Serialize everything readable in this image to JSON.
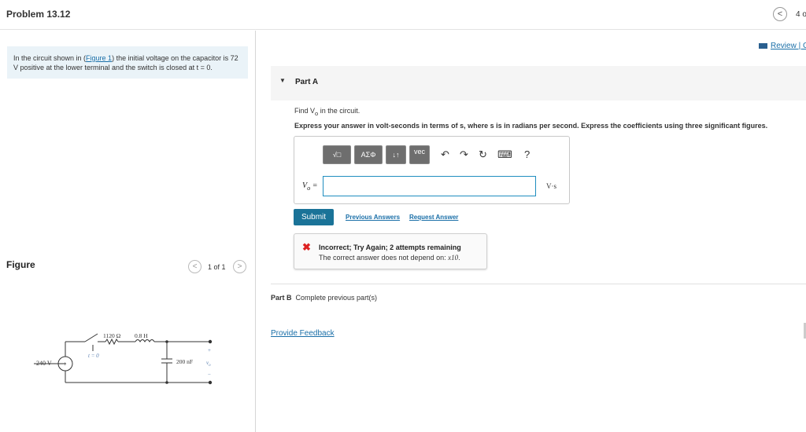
{
  "header": {
    "title": "Problem 13.12",
    "nav_prev_icon": "chevron-left-icon",
    "nav_prev_glyph": "<",
    "count": "4 o"
  },
  "left": {
    "intro_prefix": "In the circuit shown in (",
    "intro_link": "Figure 1",
    "intro_suffix": ") the initial voltage on the capacitor is 72 V positive at the lower terminal and the switch is closed at t = 0.",
    "figure_label": "Figure",
    "figure_prev_glyph": "<",
    "figure_next_glyph": ">",
    "figure_count": "1 of 1",
    "circuit": {
      "resistor": "1120 Ω",
      "inductor": "0.8 H",
      "switch": "t = 0",
      "source": "240 V",
      "capacitor": "200 nF",
      "output": "v",
      "output_sub": "o",
      "plus": "+",
      "minus": "−"
    }
  },
  "right": {
    "review_link": "Review | C",
    "part_a": "Part A",
    "question_prefix": "Find V",
    "question_sub": "o",
    "question_suffix": " in the circuit.",
    "instruction": "Express your answer in volt-seconds in terms of s, where s is in radians per second. Express the coefficients using three significant figures.",
    "toolbar": {
      "templates": "√□",
      "symbols": "ΑΣΦ",
      "sort": "↓↑",
      "vec": "vec",
      "undo": "↶",
      "redo": "↷",
      "reset": "↻",
      "keyboard": "⌨",
      "help": "?"
    },
    "answer_label": "V",
    "answer_label_sub": "o",
    "answer_label_eq": " =",
    "answer_value": "",
    "unit": "V·s",
    "submit": "Submit",
    "previous_answers": "Previous Answers",
    "request_answer": "Request Answer",
    "feedback": {
      "title": "Incorrect; Try Again; 2 attempts remaining",
      "detail_prefix": "The correct answer does not depend on: ",
      "detail_math": "x10",
      "detail_suffix": ".",
      "icon": "x-icon",
      "icon_glyph": "✖"
    },
    "part_b_label": "Part B",
    "part_b_text": "Complete previous part(s)",
    "provide_feedback": "Provide Feedback"
  },
  "colors": {
    "accent": "#1a7398",
    "link": "#1a6fa8",
    "error": "#dd2222",
    "intro_bg": "#eaf3f8"
  }
}
